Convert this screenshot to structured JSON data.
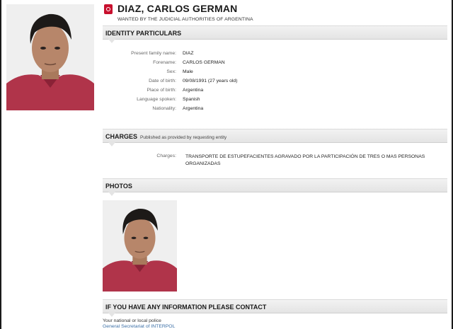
{
  "header": {
    "name": "DIAZ, CARLOS GERMAN",
    "subtitle": "WANTED BY THE JUDICIAL AUTHORITIES OF ARGENTINA",
    "brand_color": "#c8102e",
    "logo_icon": "interpol-logo-icon"
  },
  "identity": {
    "title": "IDENTITY PARTICULARS",
    "fields": [
      {
        "label": "Present family name:",
        "value": "DIAZ"
      },
      {
        "label": "Forename:",
        "value": "CARLOS GERMAN"
      },
      {
        "label": "Sex:",
        "value": "Male"
      },
      {
        "label": "Date of birth:",
        "value": "09/08/1991 (27 years old)"
      },
      {
        "label": "Place of birth:",
        "value": "Argentina"
      },
      {
        "label": "Language spoken:",
        "value": "Spanish"
      },
      {
        "label": "Nationality:",
        "value": "Argentina"
      }
    ]
  },
  "charges": {
    "title": "CHARGES",
    "subtitle": "Published as provided by requesting entity",
    "label": "Charges:",
    "text": "TRANSPORTE DE ESTUPEFACIENTES AGRAVADO POR LA PARTICIPACIÓN DE TRES O MAS PERSONAS ORGANIZADAS"
  },
  "photos": {
    "title": "PHOTOS"
  },
  "contact": {
    "title": "IF YOU HAVE ANY INFORMATION PLEASE CONTACT",
    "line1": "Your national or local police",
    "line2": "General Secretariat of INTERPOL",
    "link_color": "#3a6ea5"
  }
}
